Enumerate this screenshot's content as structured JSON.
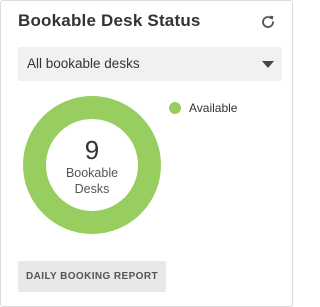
{
  "widget": {
    "title": "Bookable Desk Status",
    "refresh_icon": "refresh-icon"
  },
  "filter": {
    "selected": "All bookable desks",
    "caret_icon": "caret-down-icon"
  },
  "chart_data": {
    "type": "pie",
    "categories": [
      "Available"
    ],
    "values": [
      9
    ],
    "colors": [
      "#97ce5f"
    ],
    "center_value": "9",
    "center_label": "Bookable Desks",
    "legend_position": "top-right"
  },
  "actions": {
    "report_label": "DAILY BOOKING REPORT"
  }
}
